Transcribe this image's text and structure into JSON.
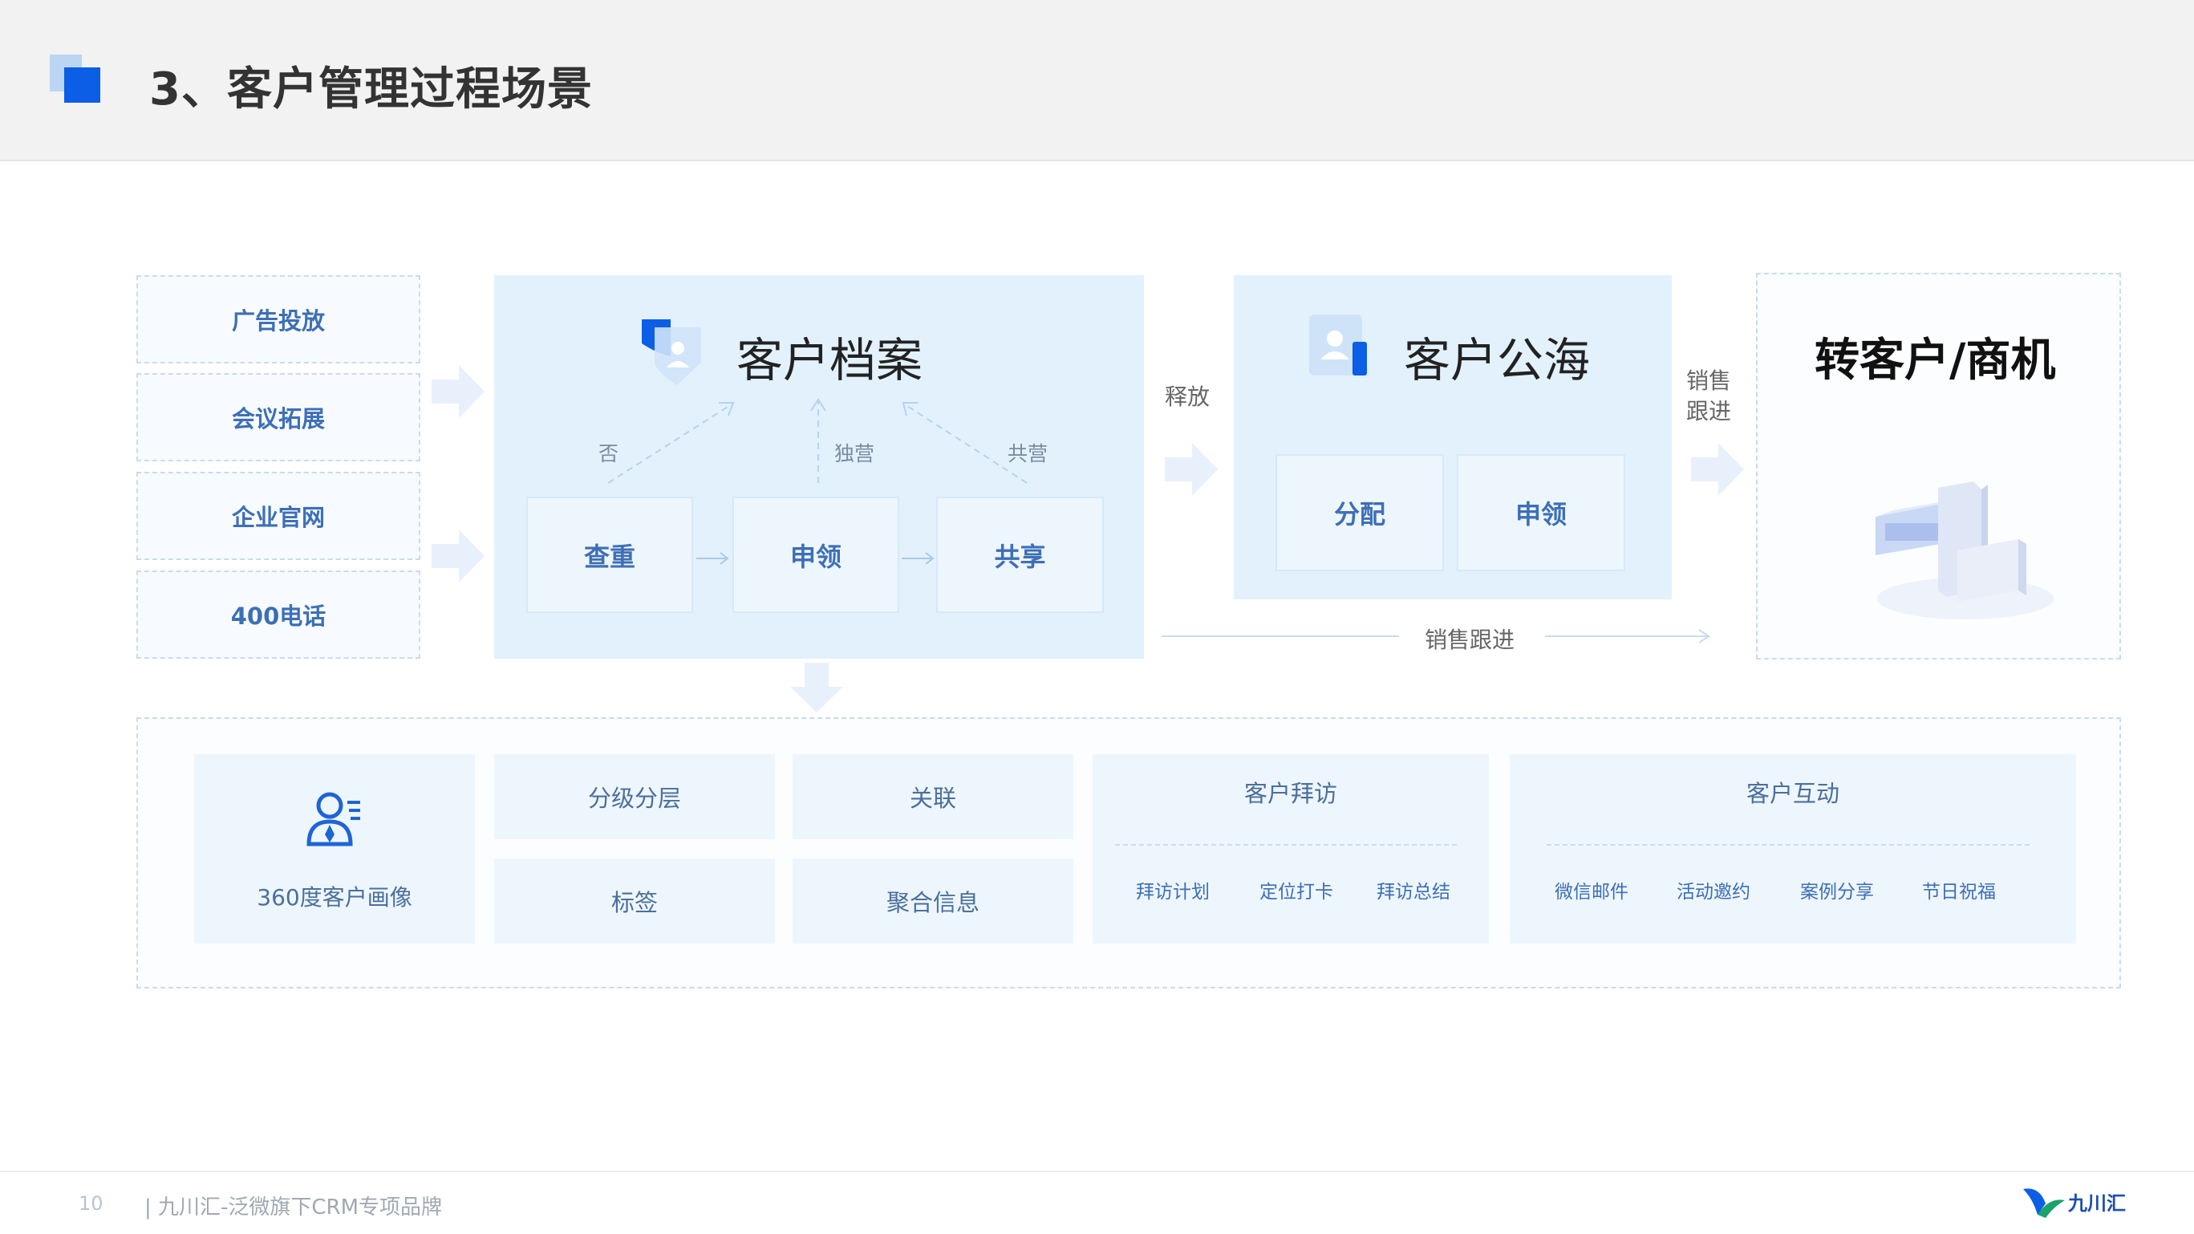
{
  "header": {
    "title": "3、客户管理过程场景"
  },
  "sources": [
    "广告投放",
    "会议拓展",
    "企业官网",
    "400电话"
  ],
  "archive": {
    "title": "客户档案",
    "steps": [
      "查重",
      "申领",
      "共享"
    ],
    "branch_labels": [
      "否",
      "独营",
      "共营"
    ]
  },
  "release_label": "释放",
  "sea": {
    "title": "客户公海",
    "actions": [
      "分配",
      "申领"
    ]
  },
  "sales_follow_side": "销售跟进",
  "sales_follow_bottom": "销售跟进",
  "convert": {
    "title": "转客户/商机"
  },
  "features": {
    "portrait": "360度客户画像",
    "grading": "分级分层",
    "association": "关联",
    "tags": "标签",
    "aggregate": "聚合信息",
    "visit": {
      "title": "客户拜访",
      "items": [
        "拜访计划",
        "定位打卡",
        "拜访总结"
      ]
    },
    "interact": {
      "title": "客户互动",
      "items": [
        "微信邮件",
        "活动邀约",
        "案例分享",
        "节日祝福"
      ]
    }
  },
  "footer": {
    "page": "10",
    "text": "| 九川汇-泛微旗下CRM专项品牌",
    "logo_text": "九川汇"
  },
  "colors": {
    "brand_blue": "#0b5ee5",
    "panel_bg": "#e3f1fd",
    "label_blue": "#3d6fb6"
  }
}
